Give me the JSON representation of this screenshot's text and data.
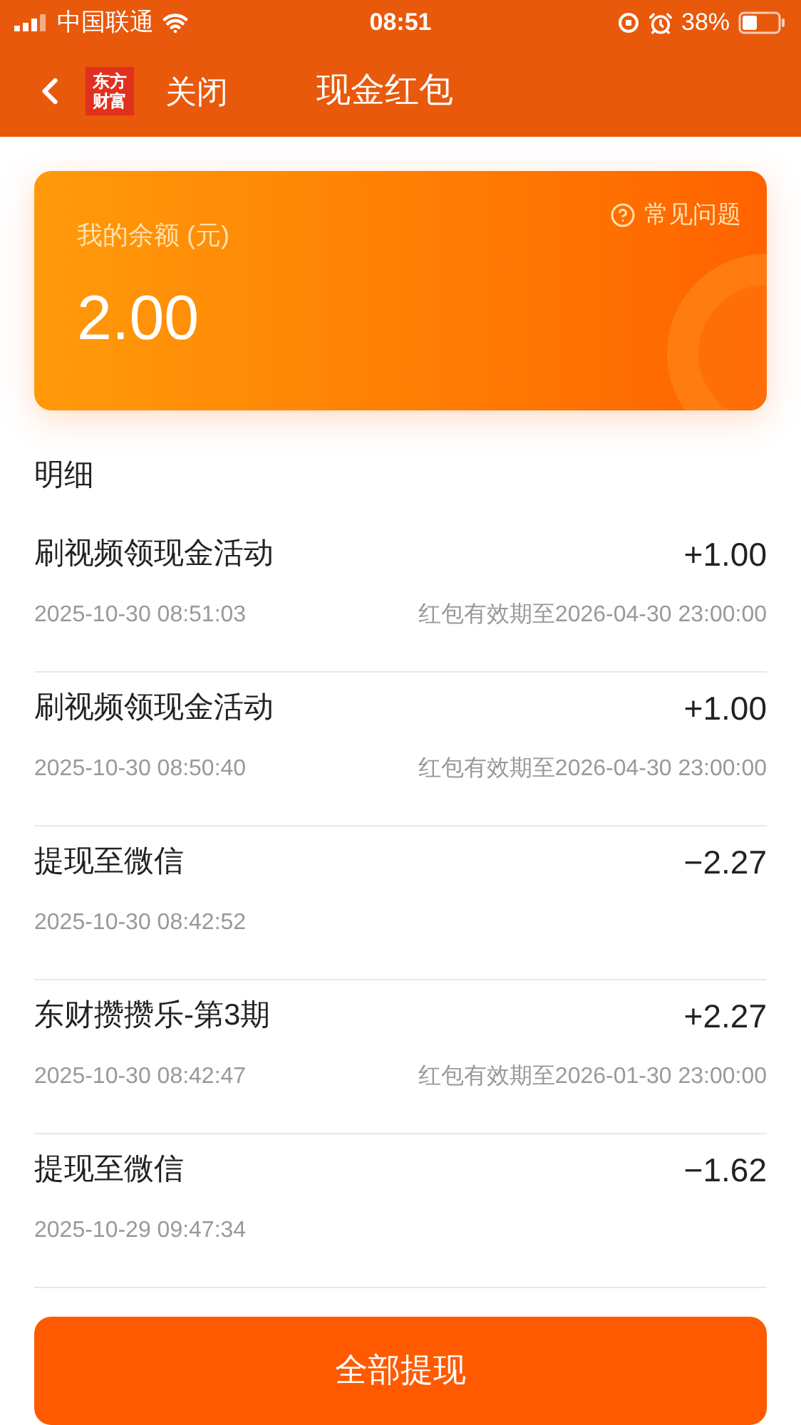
{
  "status_bar": {
    "carrier": "中国联通",
    "time": "08:51",
    "battery": "38%"
  },
  "header": {
    "logo": [
      "东方",
      "财富"
    ],
    "close": "关闭",
    "title": "现金红包"
  },
  "balance_card": {
    "label": "我的余额 (元)",
    "amount": "2.00",
    "help": "常见问题"
  },
  "section_title": "明细",
  "records": [
    {
      "title": "刷视频领现金活动",
      "amount": "+1.00",
      "time": "2025-10-30 08:51:03",
      "note": "红包有效期至2026-04-30 23:00:00"
    },
    {
      "title": "刷视频领现金活动",
      "amount": "+1.00",
      "time": "2025-10-30 08:50:40",
      "note": "红包有效期至2026-04-30 23:00:00"
    },
    {
      "title": "提现至微信",
      "amount": "−2.27",
      "time": "2025-10-30 08:42:52"
    },
    {
      "title": "东财攒攒乐-第3期",
      "amount": "+2.27",
      "time": "2025-10-30 08:42:47",
      "note": "红包有效期至2026-01-30 23:00:00"
    },
    {
      "title": "提现至微信",
      "amount": "−1.62",
      "time": "2025-10-29 09:47:34"
    }
  ],
  "withdraw_button": "全部提现"
}
